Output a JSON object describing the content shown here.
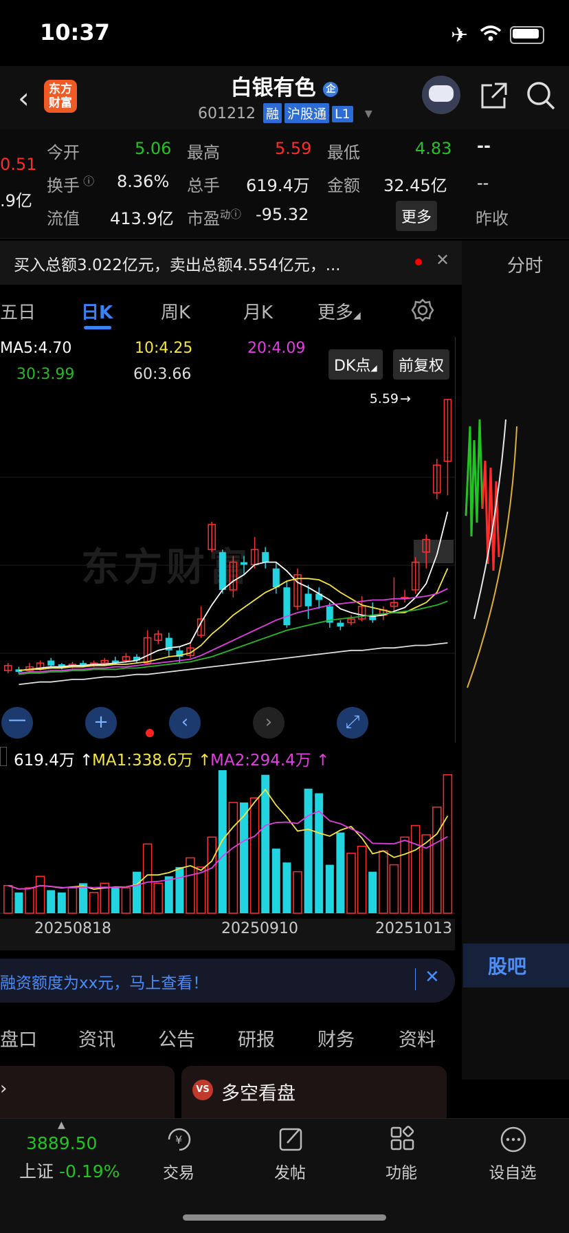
{
  "status": {
    "time": "10:37"
  },
  "header": {
    "title": "白银有色",
    "badge": "企",
    "code": "601212",
    "tags": [
      "融",
      "沪股通",
      "L1"
    ],
    "logo": "东方财富"
  },
  "quote": {
    "left_col": [
      "0.51",
      ".9亿"
    ],
    "today_open_label": "今开",
    "today_open": "5.06",
    "high_label": "最高",
    "high": "5.59",
    "low_label": "最低",
    "low": "4.83",
    "turnover_label": "换手",
    "turnover": "8.36%",
    "volume_label": "总手",
    "volume": "619.4万",
    "amount_label": "金额",
    "amount": "32.45亿",
    "float_label": "流值",
    "float_value": "413.9亿",
    "pe_label": "市盈",
    "pe_sup": "动",
    "pe": "-95.32",
    "more_label": "更多",
    "right_top": "--",
    "right_mid": "--",
    "right_bottom": "昨收"
  },
  "notice": {
    "text": "买入总额3.022亿元，卖出总额4.554亿元，..."
  },
  "sidebar": {
    "timeshare_label": "分时",
    "guba_label": "股吧"
  },
  "kline_tabs": [
    "五日",
    "日K",
    "周K",
    "月K",
    "更多"
  ],
  "ma": {
    "ma5": "MA5:4.70",
    "ma10": "10:4.25",
    "ma20": "20:4.09",
    "ma30": "30:3.99",
    "ma60": "60:3.66"
  },
  "chart_buttons": {
    "dk": "DK点",
    "fq": "前复权"
  },
  "chart_data": {
    "type": "candlestick",
    "high_marker": "5.59",
    "candles": [
      {
        "o": 3.44,
        "c": 3.48,
        "h": 3.5,
        "l": 3.42
      },
      {
        "o": 3.45,
        "c": 3.43,
        "h": 3.47,
        "l": 3.41
      },
      {
        "o": 3.44,
        "c": 3.47,
        "h": 3.5,
        "l": 3.42
      },
      {
        "o": 3.46,
        "c": 3.5,
        "h": 3.52,
        "l": 3.44
      },
      {
        "o": 3.52,
        "c": 3.48,
        "h": 3.54,
        "l": 3.46
      },
      {
        "o": 3.49,
        "c": 3.47,
        "h": 3.5,
        "l": 3.45
      },
      {
        "o": 3.48,
        "c": 3.49,
        "h": 3.51,
        "l": 3.46
      },
      {
        "o": 3.5,
        "c": 3.48,
        "h": 3.52,
        "l": 3.47
      },
      {
        "o": 3.49,
        "c": 3.5,
        "h": 3.52,
        "l": 3.47
      },
      {
        "o": 3.5,
        "c": 3.52,
        "h": 3.54,
        "l": 3.48
      },
      {
        "o": 3.52,
        "c": 3.5,
        "h": 3.55,
        "l": 3.49
      },
      {
        "o": 3.52,
        "c": 3.55,
        "h": 3.58,
        "l": 3.5
      },
      {
        "o": 3.55,
        "c": 3.52,
        "h": 3.57,
        "l": 3.5
      },
      {
        "o": 3.5,
        "c": 3.7,
        "h": 3.76,
        "l": 3.49
      },
      {
        "o": 3.68,
        "c": 3.73,
        "h": 3.76,
        "l": 3.65
      },
      {
        "o": 3.7,
        "c": 3.6,
        "h": 3.74,
        "l": 3.55
      },
      {
        "o": 3.6,
        "c": 3.55,
        "h": 3.63,
        "l": 3.5
      },
      {
        "o": 3.56,
        "c": 3.62,
        "h": 3.66,
        "l": 3.54
      },
      {
        "o": 3.72,
        "c": 3.85,
        "h": 3.95,
        "l": 3.7
      },
      {
        "o": 4.4,
        "c": 4.6,
        "h": 4.62,
        "l": 4.38
      },
      {
        "o": 4.38,
        "c": 4.08,
        "h": 4.4,
        "l": 4.05
      },
      {
        "o": 4.08,
        "c": 4.3,
        "h": 4.35,
        "l": 4.02
      },
      {
        "o": 4.3,
        "c": 4.28,
        "h": 4.35,
        "l": 4.2
      },
      {
        "o": 4.28,
        "c": 4.4,
        "h": 4.5,
        "l": 4.25
      },
      {
        "o": 4.38,
        "c": 4.3,
        "h": 4.42,
        "l": 4.25
      },
      {
        "o": 4.25,
        "c": 4.1,
        "h": 4.3,
        "l": 4.05
      },
      {
        "o": 4.1,
        "c": 3.8,
        "h": 4.15,
        "l": 3.78
      },
      {
        "o": 3.95,
        "c": 4.2,
        "h": 4.25,
        "l": 3.92
      },
      {
        "o": 4.05,
        "c": 3.95,
        "h": 4.12,
        "l": 3.85
      },
      {
        "o": 4.05,
        "c": 4.0,
        "h": 4.1,
        "l": 3.93
      },
      {
        "o": 3.95,
        "c": 3.82,
        "h": 3.98,
        "l": 3.78
      },
      {
        "o": 3.82,
        "c": 3.79,
        "h": 3.84,
        "l": 3.76
      },
      {
        "o": 3.82,
        "c": 3.85,
        "h": 3.88,
        "l": 3.8
      },
      {
        "o": 3.85,
        "c": 3.95,
        "h": 4.03,
        "l": 3.83
      },
      {
        "o": 3.88,
        "c": 3.84,
        "h": 3.98,
        "l": 3.82
      },
      {
        "o": 3.88,
        "c": 3.92,
        "h": 3.95,
        "l": 3.84
      },
      {
        "o": 3.95,
        "c": 3.98,
        "h": 4.18,
        "l": 3.9
      },
      {
        "o": 4.02,
        "c": 4.02,
        "h": 4.08,
        "l": 3.98
      },
      {
        "o": 4.08,
        "c": 4.3,
        "h": 4.34,
        "l": 4.05
      },
      {
        "o": 4.38,
        "c": 4.48,
        "h": 4.52,
        "l": 4.25
      },
      {
        "o": 4.85,
        "c": 5.07,
        "h": 5.12,
        "l": 4.8
      },
      {
        "o": 5.1,
        "c": 5.59,
        "h": 5.59,
        "l": 4.83
      }
    ],
    "ma5": [
      3.44,
      3.45,
      3.46,
      3.47,
      3.47,
      3.48,
      3.48,
      3.49,
      3.49,
      3.5,
      3.51,
      3.52,
      3.56,
      3.6,
      3.62,
      3.63,
      3.66,
      3.82,
      3.96,
      4.08,
      4.15,
      4.2,
      4.28,
      4.3,
      4.3,
      4.23,
      4.14,
      4.1,
      4.05,
      4.0,
      3.93,
      3.9,
      3.88,
      3.87,
      3.88,
      3.91,
      3.94,
      4.02,
      4.13,
      4.36,
      4.7
    ],
    "ma10": [
      3.44,
      3.45,
      3.45,
      3.46,
      3.46,
      3.47,
      3.47,
      3.48,
      3.48,
      3.49,
      3.49,
      3.5,
      3.51,
      3.53,
      3.55,
      3.56,
      3.58,
      3.64,
      3.73,
      3.8,
      3.88,
      3.94,
      4.0,
      4.06,
      4.1,
      4.15,
      4.17,
      4.17,
      4.16,
      4.12,
      4.06,
      4.01,
      3.96,
      3.94,
      3.92,
      3.9,
      3.9,
      3.94,
      3.98,
      4.06,
      4.25
    ],
    "ma20": [
      3.42,
      3.43,
      3.43,
      3.44,
      3.44,
      3.45,
      3.45,
      3.46,
      3.46,
      3.47,
      3.47,
      3.48,
      3.49,
      3.5,
      3.51,
      3.52,
      3.53,
      3.56,
      3.6,
      3.64,
      3.68,
      3.72,
      3.76,
      3.8,
      3.84,
      3.87,
      3.9,
      3.92,
      3.94,
      3.96,
      3.97,
      3.98,
      3.99,
      4.0,
      4.0,
      4.01,
      4.01,
      4.02,
      4.03,
      4.05,
      4.09
    ],
    "ma30": [
      3.41,
      3.42,
      3.42,
      3.43,
      3.43,
      3.44,
      3.44,
      3.45,
      3.45,
      3.45,
      3.46,
      3.46,
      3.47,
      3.48,
      3.49,
      3.5,
      3.51,
      3.53,
      3.55,
      3.58,
      3.61,
      3.64,
      3.67,
      3.7,
      3.73,
      3.76,
      3.78,
      3.8,
      3.82,
      3.84,
      3.85,
      3.86,
      3.87,
      3.88,
      3.89,
      3.9,
      3.91,
      3.92,
      3.94,
      3.96,
      3.99
    ],
    "ma60": [
      3.33,
      3.34,
      3.35,
      3.35,
      3.36,
      3.37,
      3.37,
      3.38,
      3.39,
      3.39,
      3.4,
      3.41,
      3.41,
      3.42,
      3.43,
      3.44,
      3.45,
      3.46,
      3.47,
      3.48,
      3.49,
      3.5,
      3.51,
      3.52,
      3.53,
      3.54,
      3.55,
      3.56,
      3.57,
      3.58,
      3.59,
      3.6,
      3.6,
      3.61,
      3.62,
      3.62,
      3.63,
      3.64,
      3.64,
      3.65,
      3.66
    ],
    "volume_legend": {
      "vol": "619.4万",
      "ma1": "MA1:338.6万",
      "ma2": "MA2:294.4万"
    },
    "volumes": [
      120,
      90,
      110,
      160,
      100,
      90,
      110,
      130,
      90,
      130,
      110,
      110,
      180,
      300,
      130,
      160,
      200,
      240,
      200,
      330,
      620,
      480,
      480,
      500,
      600,
      280,
      220,
      180,
      540,
      520,
      210,
      350,
      260,
      290,
      180,
      270,
      210,
      330,
      380,
      340,
      460,
      600
    ],
    "x_labels": [
      "20250818",
      "20250910",
      "20251013"
    ]
  },
  "chart_controls": {
    "zoom_out": "一",
    "zoom_in": "+",
    "prev": "‹",
    "next": "›",
    "fullscreen": "⤢"
  },
  "banner": {
    "text": "融资额度为xx元，马上查看！"
  },
  "bottom_tabs": [
    "盘口",
    "资讯",
    "公告",
    "研报",
    "财务",
    "资料"
  ],
  "cards": {
    "card2_icon": "VS",
    "card2_label": "多空看盘"
  },
  "nav": {
    "index_value": "3889.50",
    "index_name": "上证",
    "index_change": "-0.19%",
    "items": [
      "交易",
      "发帖",
      "功能",
      "设自选"
    ]
  }
}
